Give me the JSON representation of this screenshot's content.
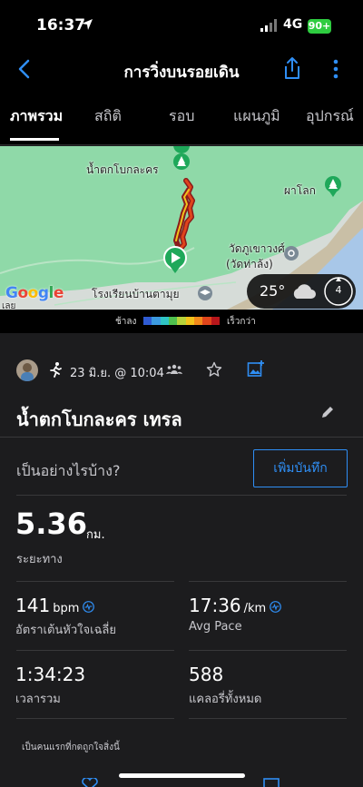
{
  "status_bar": {
    "time": "16:37",
    "network": "4G",
    "battery": "90+"
  },
  "nav": {
    "title": "การวิ่งบนรอยเดิน"
  },
  "tabs": [
    {
      "label": "ภาพรวม",
      "active": true
    },
    {
      "label": "สถิติ",
      "active": false
    },
    {
      "label": "รอบ",
      "active": false
    },
    {
      "label": "แผนภูมิ",
      "active": false
    },
    {
      "label": "อุปกรณ์",
      "active": false
    }
  ],
  "map": {
    "labels": {
      "waterfall": "น้ำตกโบกละคร",
      "pha_lok": "ผาโลก",
      "temple": "วัดภูเขาวงศ์",
      "temple_sub": "(วัดท่าล้ง)",
      "school": "โรงเรียนบ้านตามุย",
      "edge": "เลย"
    },
    "google": "Google",
    "weather": {
      "temperature": "25°",
      "wind": "4"
    }
  },
  "legend": {
    "slow_label": "ช้าลง",
    "fast_label": "เร็วกว่า",
    "colors": [
      "#2f5bd3",
      "#3b9ae0",
      "#2fc4c4",
      "#4fc14f",
      "#b7d33a",
      "#f2c21b",
      "#f28a1b",
      "#e0451b",
      "#b8161b"
    ]
  },
  "activity": {
    "date": "23 มิ.ย. @ 10:04",
    "title": "น้ำตกโบกละคร เทรล",
    "note_prompt": "เป็นอย่างไรบ้าง?",
    "add_note_label": "เพิ่มบันทึก"
  },
  "stats": {
    "distance": {
      "value": "5.36",
      "unit": "กม.",
      "label": "ระยะทาง"
    },
    "heart_rate": {
      "value": "141",
      "unit": "bpm",
      "label": "อัตราเต้นหัวใจเฉลี่ย"
    },
    "pace": {
      "value": "17:36",
      "unit": "/km",
      "label": "Avg Pace"
    },
    "total_time": {
      "value": "1:34:23",
      "label": "เวลารวม"
    },
    "calories": {
      "value": "588",
      "label": "แคลอรี่ทั้งหมด"
    }
  },
  "kudos_text": "เป็นคนแรกที่กดถูกใจสิ่งนี้"
}
